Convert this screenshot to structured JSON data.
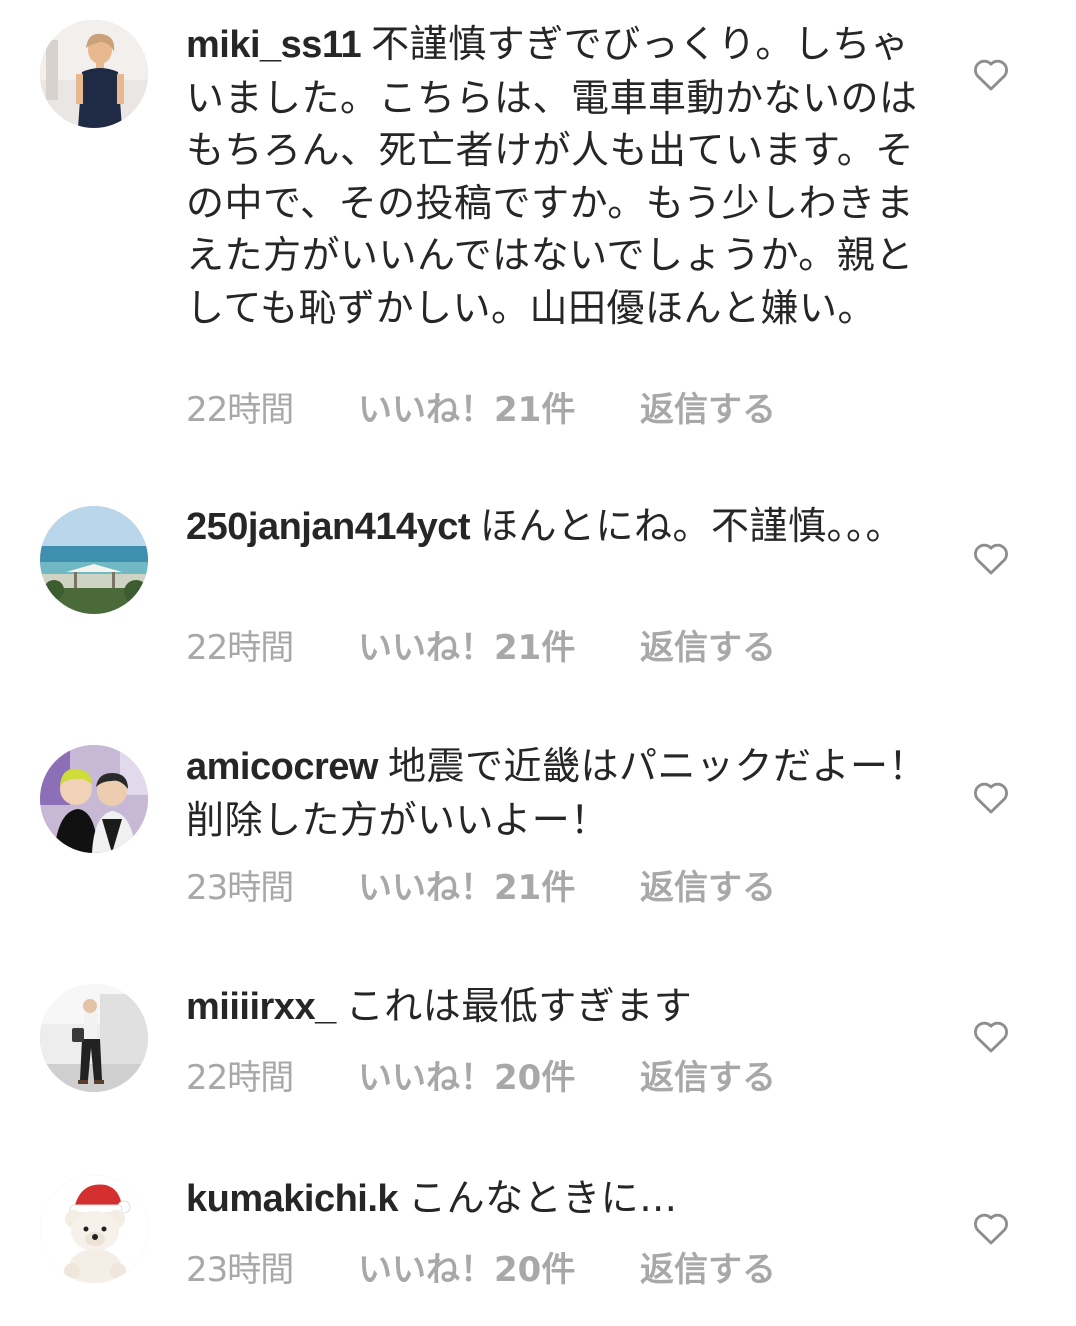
{
  "comments": [
    {
      "username": "miki_ss11",
      "text": "不謹慎すぎでびっくり。しちゃいました。こちらは、電車車動かないのはもちろん、死亡者けが人も出ています。その中で、その投稿ですか。もう少しわきまえた方がいいんではないでしょうか。親としても恥ずかしい。山田優ほんと嫌い。",
      "time": "22時間",
      "likes": "いいね！21件",
      "reply": "返信する",
      "avatar_icon": "profile-photo-woman-icon"
    },
    {
      "username": "250janjan414yct",
      "text": "ほんとにね。不謹慎。。。",
      "time": "22時間",
      "likes": "いいね！21件",
      "reply": "返信する",
      "avatar_icon": "profile-photo-beach-icon"
    },
    {
      "username": "amicocrew",
      "text": "地震で近畿はパニックだよー！削除した方がいいよー！",
      "time": "23時間",
      "likes": "いいね！21件",
      "reply": "返信する",
      "avatar_icon": "profile-photo-two-people-icon"
    },
    {
      "username": "miiiirxx_",
      "text": "これは最低すぎます",
      "time": "22時間",
      "likes": "いいね！20件",
      "reply": "返信する",
      "avatar_icon": "profile-photo-standing-person-icon"
    },
    {
      "username": "kumakichi.k",
      "text": "こんなときに…",
      "time": "23時間",
      "likes": "いいね！20件",
      "reply": "返信する",
      "avatar_icon": "profile-photo-teddy-bear-icon"
    }
  ],
  "heart_icon": "heart-outline-icon",
  "colors": {
    "text": "#262626",
    "meta": "#a8a8a8",
    "heart": "#8e8e8e"
  }
}
